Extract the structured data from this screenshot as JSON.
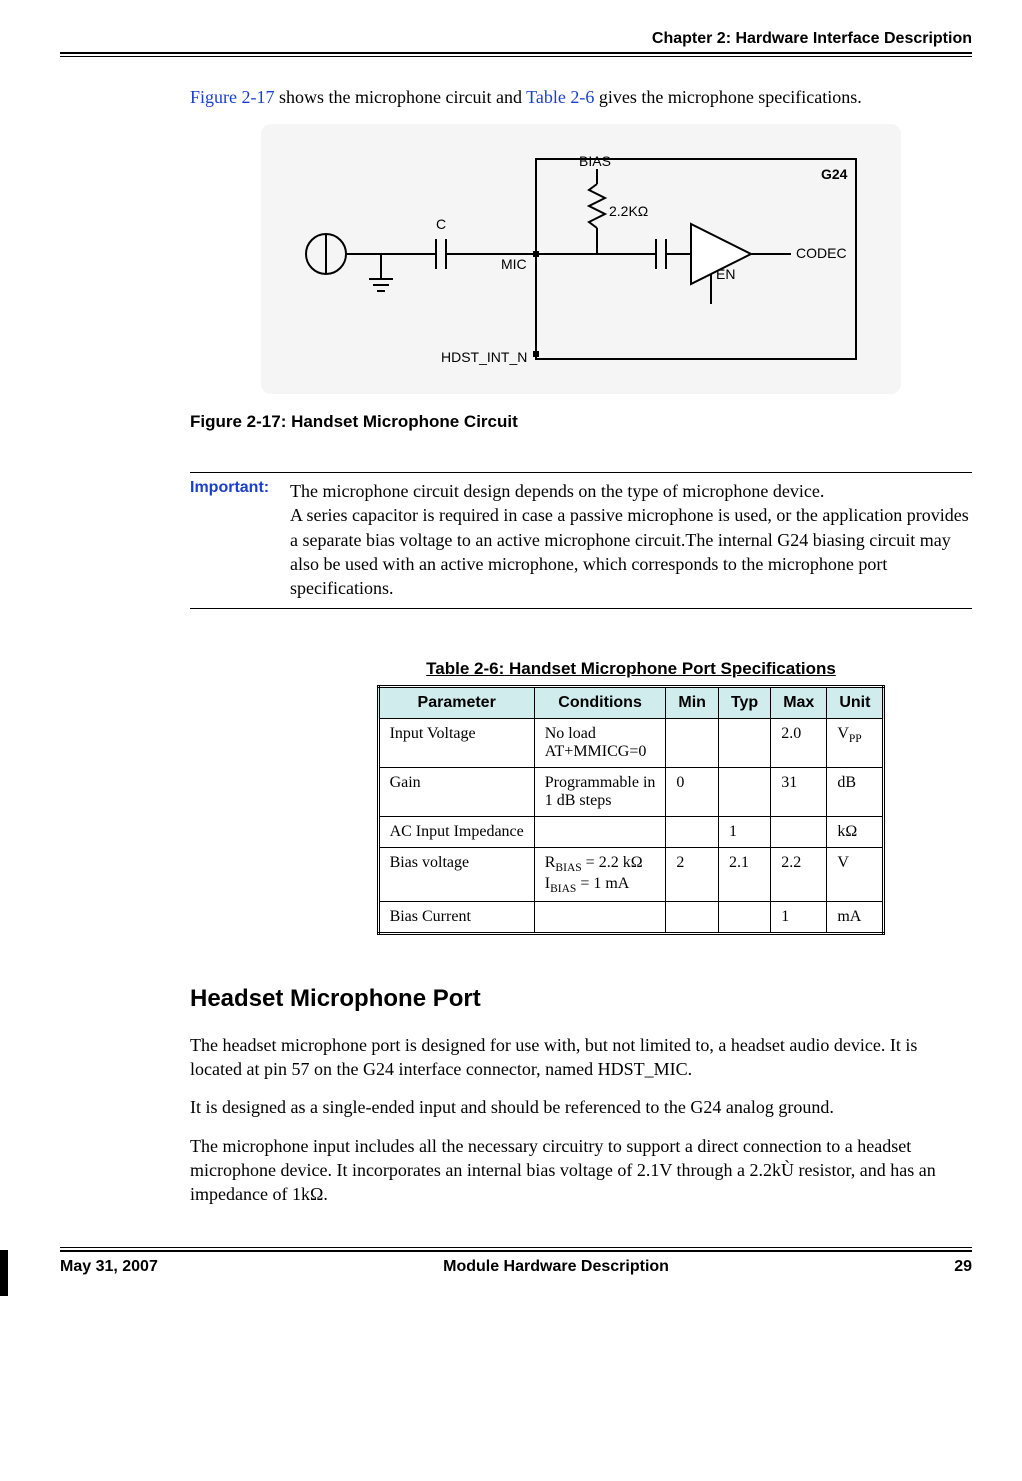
{
  "header": {
    "chapter": "Chapter 2:  Hardware Interface Description"
  },
  "intro": {
    "before": "",
    "figref": "Figure 2-17",
    "mid": " shows the microphone circuit and ",
    "tblref": "Table 2-6",
    "after": " gives the microphone specifications."
  },
  "figure": {
    "caption": "Figure 2-17: Handset Microphone Circuit",
    "labels": {
      "bias": "BIAS",
      "g24": "G24",
      "codec": "CODEC",
      "mic": "MIC",
      "en": "EN",
      "c": "C",
      "rval": "2.2KΩ",
      "hdst": "HDST_INT_N"
    }
  },
  "note": {
    "label": "Important:",
    "text": "The microphone circuit design depends on the type of microphone device.\nA series capacitor is required in case a passive microphone is used, or the application provides a separate bias voltage to an active microphone circuit.The internal G24 biasing circuit may also be used with an active microphone, which corresponds to the microphone port specifications."
  },
  "table": {
    "caption_pre": "Table 2-6:",
    "caption_rest": " Handset Microphone Port Specifications ",
    "headers": {
      "p": "Parameter",
      "c": "Conditions",
      "min": "Min",
      "typ": "Typ",
      "max": "Max",
      "u": "Unit"
    },
    "rows": [
      {
        "param": "Input Voltage",
        "cond_plain": "No load\nAT+MMICG=0",
        "cond_html": "No load<br>AT+MMICG=0",
        "min": "",
        "typ": "",
        "max": "2.0",
        "unit_html": "V<sub>PP</sub>"
      },
      {
        "param": "Gain",
        "cond_plain": "Programmable in 1 dB steps",
        "cond_html": "Programmable in<br>1 dB steps",
        "min": "0",
        "typ": "",
        "max": "31",
        "unit_html": "dB"
      },
      {
        "param": "AC Input Impedance",
        "cond_plain": "",
        "cond_html": "",
        "min": "",
        "typ": "1",
        "max": "",
        "unit_html": "kΩ"
      },
      {
        "param": "Bias voltage",
        "cond_plain": "RBIAS = 2.2 kΩ\nIBIAS = 1 mA",
        "cond_html": "R<sub>BIAS</sub> = 2.2 kΩ<br>I<sub>BIAS</sub> = 1 mA",
        "min": "2",
        "typ": "2.1",
        "max": "2.2",
        "unit_html": "V"
      },
      {
        "param": "Bias Current",
        "cond_plain": "",
        "cond_html": "",
        "min": "",
        "typ": "",
        "max": "1",
        "unit_html": "mA"
      }
    ]
  },
  "section2": {
    "title": "Headset Microphone Port",
    "p1": "The headset microphone port is designed for use with, but not limited to, a headset audio device. It is located at pin 57 on the G24 interface connector, named HDST_MIC.",
    "p2": "It is designed as a single-ended input and should be referenced to the G24 analog ground.",
    "p3": "The microphone input includes all the necessary circuitry to support a direct connection to a headset microphone device. It incorporates an internal bias voltage of 2.1V through a 2.2kÙ resistor, and has an impedance of 1kΩ."
  },
  "footer": {
    "date": "May 31, 2007",
    "title": "Module Hardware Description",
    "page": "29"
  }
}
